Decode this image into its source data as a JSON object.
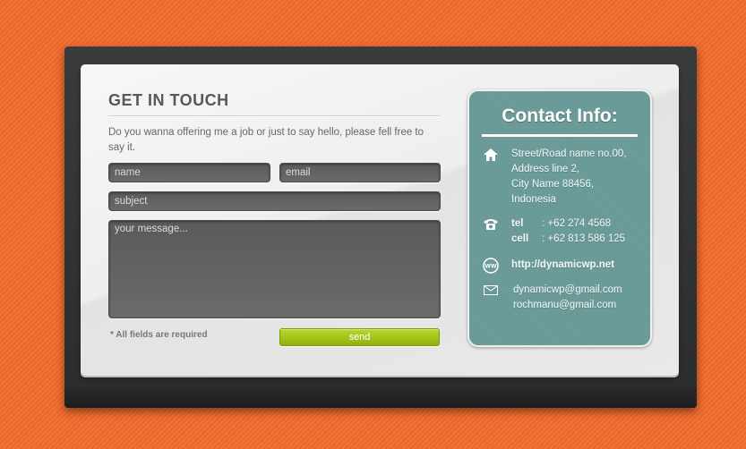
{
  "form": {
    "title": "GET IN TOUCH",
    "intro": "Do you wanna offering me a job or just to say hello, please fell free to say it.",
    "name_placeholder": "name",
    "email_placeholder": "email",
    "subject_placeholder": "subject",
    "message_placeholder": "your message...",
    "required_note": "* All fields are required",
    "send_label": "send"
  },
  "contact": {
    "title": "Contact Info:",
    "address_lines": [
      "Street/Road name no.00,",
      "Address line 2,",
      "City Name 88456,",
      "Indonesia"
    ],
    "tel_label": "tel",
    "tel_value": ": +62 274 4568",
    "cell_label": "cell",
    "cell_value": ": +62 813 586 125",
    "website": "http://dynamicwp.net",
    "emails": [
      "dynamicwp@gmail.com",
      "rochmanu@gmail.com"
    ],
    "icons": [
      "home-icon",
      "phone-icon",
      "www-icon",
      "mail-icon"
    ]
  },
  "colors": {
    "background": "#f26a2c",
    "contact_box": "#6a9c9a",
    "send_button": "#a3c61b"
  }
}
